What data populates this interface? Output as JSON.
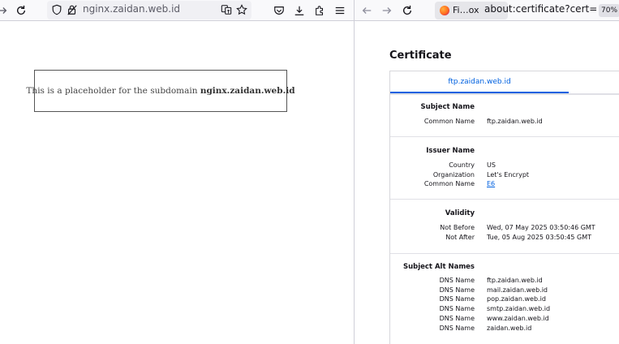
{
  "left_window": {
    "url": "nginx.zaidan.web.id",
    "placeholder": {
      "prefix": "This is a placeholder for the subdomain ",
      "domain": "nginx.zaidan.web.id"
    }
  },
  "right_window": {
    "tab_title": "Fi…ox",
    "url": "about:certificate?cert=MIIELDCC",
    "zoom": "70%",
    "heading": "Certificate",
    "tab": "ftp.zaidan.web.id",
    "sections": {
      "subject": {
        "title": "Subject Name",
        "rows": [
          {
            "label": "Common Name",
            "value": "ftp.zaidan.web.id"
          }
        ]
      },
      "issuer": {
        "title": "Issuer Name",
        "rows": [
          {
            "label": "Country",
            "value": "US"
          },
          {
            "label": "Organization",
            "value": "Let's Encrypt"
          },
          {
            "label": "Common Name",
            "value": "E6"
          }
        ]
      },
      "validity": {
        "title": "Validity",
        "rows": [
          {
            "label": "Not Before",
            "value": "Wed, 07 May 2025 03:50:46 GMT"
          },
          {
            "label": "Not After",
            "value": "Tue, 05 Aug 2025 03:50:45 GMT"
          }
        ]
      },
      "san": {
        "title": "Subject Alt Names",
        "rows": [
          {
            "label": "DNS Name",
            "value": "ftp.zaidan.web.id"
          },
          {
            "label": "DNS Name",
            "value": "mail.zaidan.web.id"
          },
          {
            "label": "DNS Name",
            "value": "pop.zaidan.web.id"
          },
          {
            "label": "DNS Name",
            "value": "smtp.zaidan.web.id"
          },
          {
            "label": "DNS Name",
            "value": "www.zaidan.web.id"
          },
          {
            "label": "DNS Name",
            "value": "zaidan.web.id"
          }
        ]
      }
    }
  }
}
